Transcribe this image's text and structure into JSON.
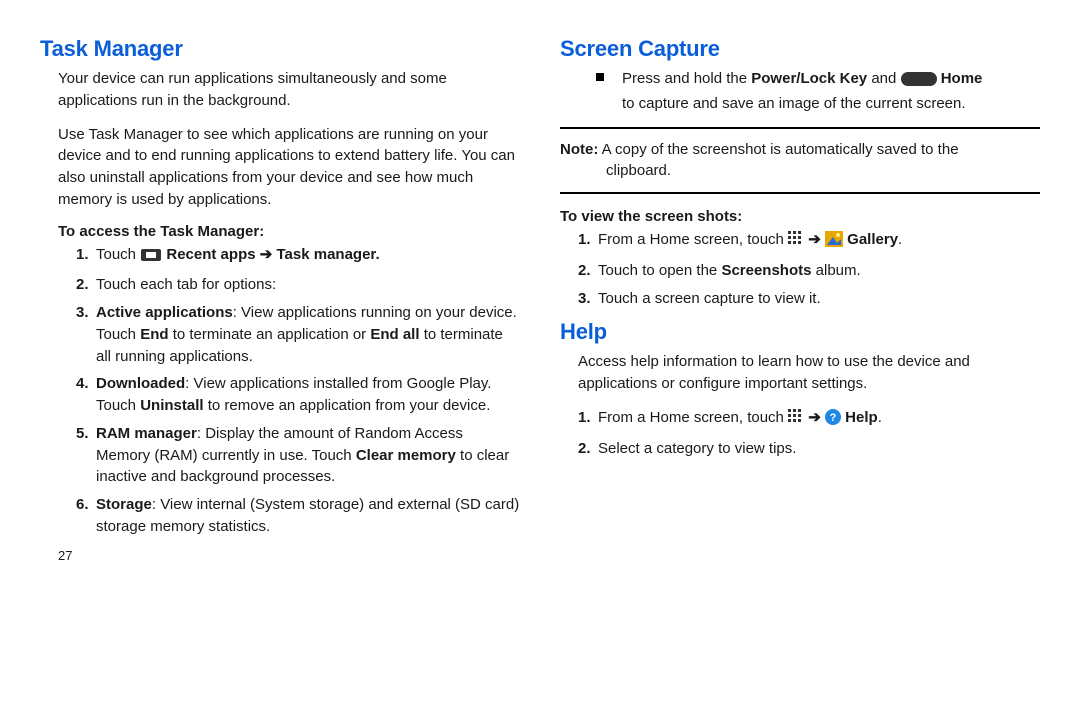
{
  "left": {
    "h_task_manager": "Task Manager",
    "p_intro1": "Your device can run applications simultaneously and some applications run in the background.",
    "p_intro2": "Use Task Manager to see which applications are running on your device and to end running applications to extend battery life. You can also uninstall applications from your device and see how much memory is used by applications.",
    "sub_access": "To access the Task Manager:",
    "s1_touch": "Touch ",
    "s1_recent": " Recent apps ",
    "s1_taskmgr": " Task manager.",
    "s2": "Touch each tab for options:",
    "s3_label": "Active applications",
    "s3_rest": ": View applications running on your device. Touch ",
    "s3_end": "End",
    "s3_rest2": " to terminate an application or ",
    "s3_endall": "End all",
    "s3_rest3": " to terminate all running applications.",
    "s4_label": "Downloaded",
    "s4_rest": ": View applications installed from Google Play. Touch ",
    "s4_uninstall": "Uninstall",
    "s4_rest2": " to remove an application from your device.",
    "s5_label": "RAM manager",
    "s5_rest": ": Display the amount of Random Access Memory (RAM) currently in use. Touch ",
    "s5_clear": "Clear memory",
    "s5_rest2": " to clear inactive and background processes.",
    "s6_label": "Storage",
    "s6_rest": ": View internal (System storage) and external (SD card) storage memory statistics.",
    "pagenum": "27"
  },
  "right": {
    "h_screen_capture": "Screen Capture",
    "b_phold": "Press and hold the ",
    "b_power": "Power/Lock Key",
    "b_and": " and ",
    "b_home": " Home",
    "b_rest": "to capture and save an image of the current screen.",
    "note_label": "Note:",
    "note_text": " A copy of the screenshot is automatically saved to the ",
    "note_clip": "clipboard.",
    "sub_view": "To view the screen shots:",
    "v1_a": "From a Home screen, touch ",
    "v1_gallery": " Gallery",
    "v2_a": "Touch to open the ",
    "v2_ss": "Screenshots",
    "v2_b": " album.",
    "v3": "Touch a screen capture to view it.",
    "h_help": "Help",
    "help_p": "Access help information to learn how to use the device and applications or configure important settings.",
    "h1_a": "From a Home screen, touch ",
    "h1_help": " Help",
    "h2": "Select a category to view tips."
  }
}
